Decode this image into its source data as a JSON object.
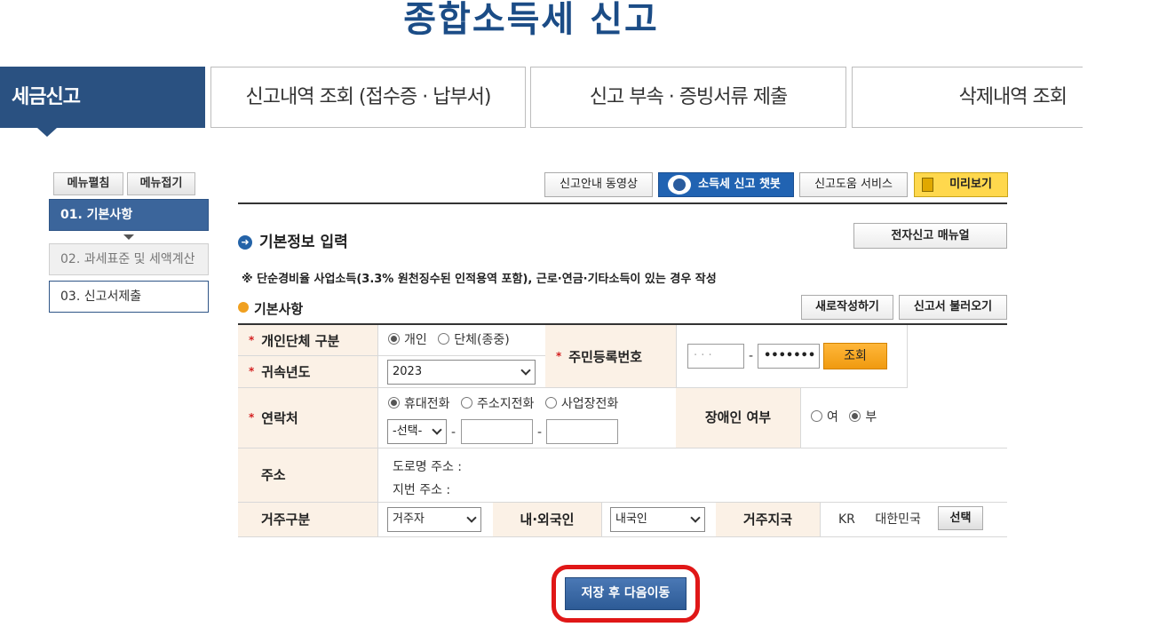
{
  "page": {
    "title": "종합소득세 신고"
  },
  "tabs": {
    "active": "세금신고",
    "items": [
      "신고내역 조회 (접수증 · 납부서)",
      "신고 부속 · 증빙서류 제출",
      "삭제내역 조회"
    ]
  },
  "sidebar": {
    "expand_all": "메뉴펼침",
    "collapse_all": "메뉴접기",
    "steps": [
      "01. 기본사항",
      "02. 과세표준 및 세액계산",
      "03. 신고서제출"
    ]
  },
  "toolbar": {
    "guide_video": "신고안내 동영상",
    "chatbot": "소득세 신고 챗봇",
    "help_service": "신고도움 서비스",
    "preview": "미리보기"
  },
  "section": {
    "title": "기본정보 입력",
    "manual_button": "전자신고 매뉴얼",
    "note": "※ 단순경비율 사업소득(3.3% 원천징수된 인적용역 포함), 근로·연금·기타소득이 있는 경우 작성",
    "subtitle": "기본사항",
    "new_button": "새로작성하기",
    "load_button": "신고서 불러오기"
  },
  "form": {
    "type_label": "개인단체 구분",
    "type_options": [
      "개인",
      "단체(종중)"
    ],
    "type_selected": "개인",
    "year_label": "귀속년도",
    "year_value": "2023",
    "rrn_label": "주민등록번호",
    "rrn_first": "· ·  ·",
    "rrn_second": "•••••••",
    "rrn_sep": "-",
    "lookup_button": "조회",
    "contact_label": "연락처",
    "contact_options": [
      "휴대전화",
      "주소지전화",
      "사업장전화"
    ],
    "contact_selected": "휴대전화",
    "phone_prefix": "-선택-",
    "phone_sep": "-",
    "disabled_label": "장애인 여부",
    "disabled_options": [
      "여",
      "부"
    ],
    "disabled_selected": "부",
    "address_label": "주소",
    "road_address": "도로명 주소 :",
    "lot_address": "지번 주소 :",
    "residence_label": "거주구분",
    "residence_value": "거주자",
    "nationality_label": "내·외국인",
    "nationality_value": "내국인",
    "country_label": "거주지국",
    "country_code": "KR",
    "country_name": "대한민국",
    "country_select_button": "선택"
  },
  "actions": {
    "save_next": "저장 후 다음이동"
  },
  "colors": {
    "brand": "#2a5181",
    "accent": "#f09a10",
    "highlight": "#e01717"
  }
}
